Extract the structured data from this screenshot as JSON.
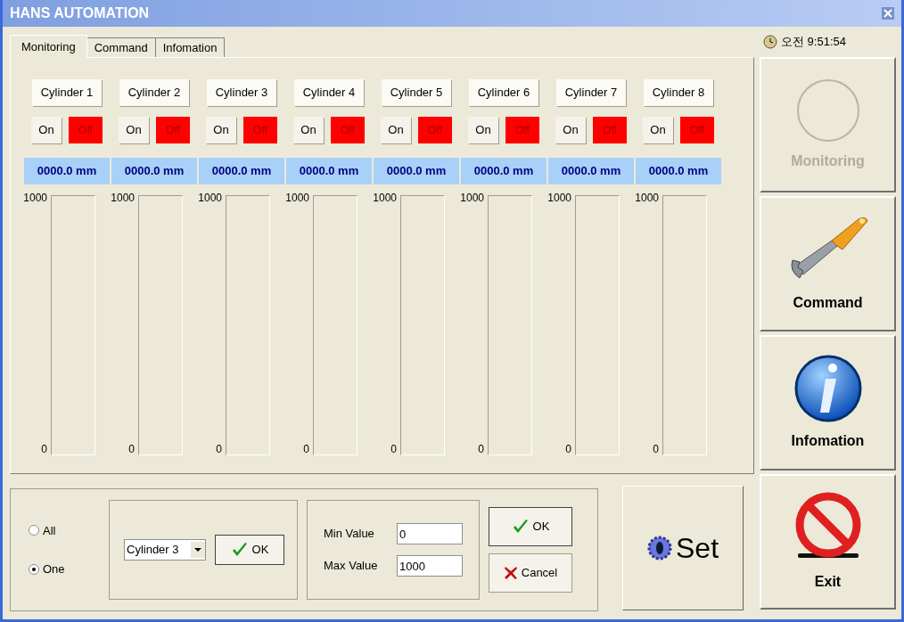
{
  "window": {
    "title": "HANS AUTOMATION"
  },
  "tabs": [
    {
      "label": "Monitoring",
      "selected": true
    },
    {
      "label": "Command",
      "selected": false
    },
    {
      "label": "Infomation",
      "selected": false
    }
  ],
  "clock": "오전 9:51:54",
  "cylinders": [
    {
      "name": "Cylinder 1",
      "on_label": "On",
      "off_label": "Off",
      "on": false,
      "reading": "0000.0 mm",
      "max": "1000",
      "min": "0",
      "level": 0
    },
    {
      "name": "Cylinder 2",
      "on_label": "On",
      "off_label": "Off",
      "on": false,
      "reading": "0000.0 mm",
      "max": "1000",
      "min": "0",
      "level": 0
    },
    {
      "name": "Cylinder 3",
      "on_label": "On",
      "off_label": "Off",
      "on": false,
      "reading": "0000.0 mm",
      "max": "1000",
      "min": "0",
      "level": 0
    },
    {
      "name": "Cylinder 4",
      "on_label": "On",
      "off_label": "Off",
      "on": false,
      "reading": "0000.0 mm",
      "max": "1000",
      "min": "0",
      "level": 0
    },
    {
      "name": "Cylinder 5",
      "on_label": "On",
      "off_label": "Off",
      "on": false,
      "reading": "0000.0 mm",
      "max": "1000",
      "min": "0",
      "level": 0
    },
    {
      "name": "Cylinder 6",
      "on_label": "On",
      "off_label": "Off",
      "on": false,
      "reading": "0000.0 mm",
      "max": "1000",
      "min": "0",
      "level": 0
    },
    {
      "name": "Cylinder 7",
      "on_label": "On",
      "off_label": "Off",
      "on": false,
      "reading": "0000.0 mm",
      "max": "1000",
      "min": "0",
      "level": 0
    },
    {
      "name": "Cylinder 8",
      "on_label": "On",
      "off_label": "Off",
      "on": false,
      "reading": "0000.0 mm",
      "max": "1000",
      "min": "0",
      "level": 0
    }
  ],
  "scope": [
    {
      "label": "All",
      "selected": false
    },
    {
      "label": "One",
      "selected": true
    }
  ],
  "cylinder_select": {
    "value": "Cylinder 3",
    "button": "OK"
  },
  "range": {
    "min_label": "Min Value",
    "min_value": "0",
    "max_label": "Max Value",
    "max_value": "1000"
  },
  "range_buttons": {
    "ok": "OK",
    "cancel": "Cancel"
  },
  "set_button": "Set",
  "side_buttons": [
    {
      "kind": "monitoring",
      "label": "Monitoring",
      "disabled": true
    },
    {
      "kind": "command",
      "label": "Command",
      "disabled": false
    },
    {
      "kind": "information",
      "label": "Infomation",
      "disabled": false
    },
    {
      "kind": "exit",
      "label": "Exit",
      "disabled": false
    }
  ]
}
